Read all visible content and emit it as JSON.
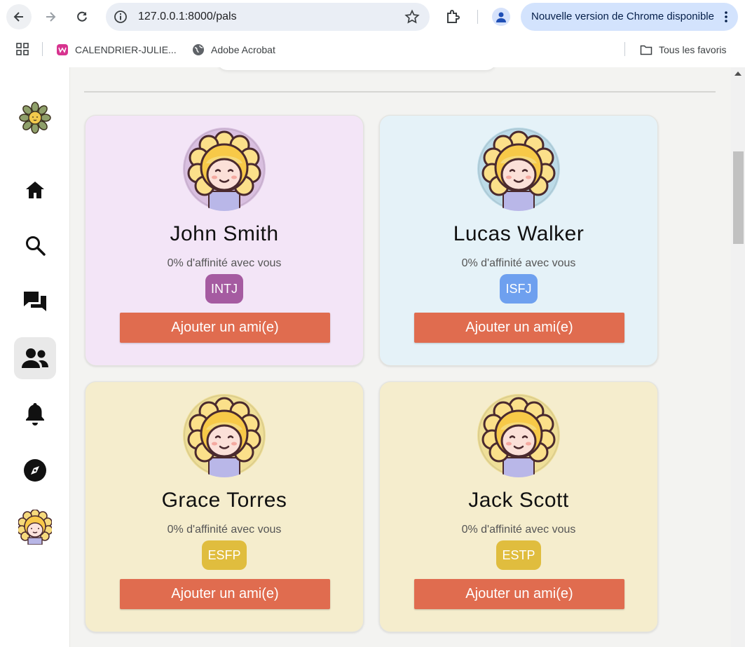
{
  "browser": {
    "url": "127.0.0.1:8000/pals",
    "update_banner": "Nouvelle version de Chrome disponible",
    "bookmarks": [
      {
        "label": "CALENDRIER-JULIE...",
        "icon": "wix-icon"
      },
      {
        "label": "Adobe Acrobat",
        "icon": "globe-icon"
      }
    ],
    "all_bookmarks": "Tous les favoris"
  },
  "sidebar": {
    "items": [
      {
        "name": "logo",
        "icon": "flower-logo-icon"
      },
      {
        "name": "home",
        "icon": "home-icon"
      },
      {
        "name": "search",
        "icon": "search-icon"
      },
      {
        "name": "messages",
        "icon": "chat-icon"
      },
      {
        "name": "pals",
        "icon": "users-icon",
        "active": true
      },
      {
        "name": "notifications",
        "icon": "bell-icon"
      },
      {
        "name": "explore",
        "icon": "compass-icon"
      },
      {
        "name": "profile",
        "icon": "avatar-icon"
      }
    ]
  },
  "colors": {
    "accent_button": "#e06c4f",
    "intj_badge": "#a55ba1",
    "isfj_badge": "#6ea0ef",
    "esfp_badge": "#e0bd3e",
    "estp_badge": "#e0bd3e"
  },
  "cards": [
    {
      "name": "John Smith",
      "affinity": "0% d'affinité avec vous",
      "type": "INTJ",
      "button": "Ajouter un ami(e)",
      "bg": "#f3e5f7",
      "ring": "#d9bfe0",
      "badge_color": "#a55ba1"
    },
    {
      "name": "Lucas Walker",
      "affinity": "0% d'affinité avec vous",
      "type": "ISFJ",
      "button": "Ajouter un ami(e)",
      "bg": "#e5f2f8",
      "ring": "#bcdbe8",
      "badge_color": "#6ea0ef"
    },
    {
      "name": "Grace Torres",
      "affinity": "0% d'affinité avec vous",
      "type": "ESFP",
      "button": "Ajouter un ami(e)",
      "bg": "#f5edcd",
      "ring": "#efdf98",
      "badge_color": "#e0bd3e"
    },
    {
      "name": "Jack Scott",
      "affinity": "0% d'affinité avec vous",
      "type": "ESTP",
      "button": "Ajouter un ami(e)",
      "bg": "#f5edcd",
      "ring": "#efdf98",
      "badge_color": "#e0bd3e"
    }
  ]
}
